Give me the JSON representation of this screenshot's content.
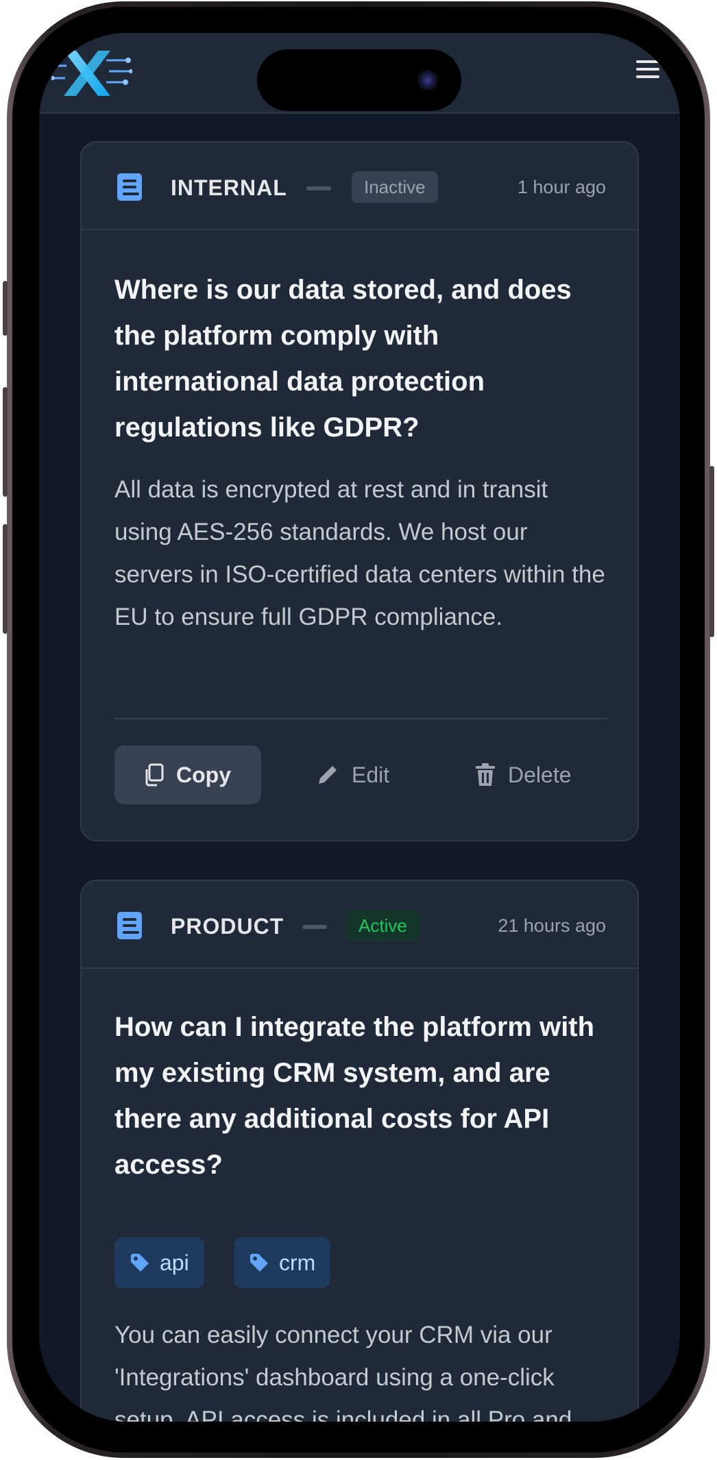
{
  "header": {
    "logo_alt": "X logo",
    "menu_icon": "hamburger-menu-icon"
  },
  "cards": [
    {
      "category": "INTERNAL",
      "status": "Inactive",
      "time": "1 hour ago",
      "question": "Where is our data stored, and does the platform comply with international data protection regulations like GDPR?",
      "answer": "All data is encrypted at rest and in transit using AES-256 standards. We host our servers in ISO-certified data centers within the EU to ensure full GDPR compliance.",
      "actions": {
        "copy": "Copy",
        "edit": "Edit",
        "delete": "Delete"
      }
    },
    {
      "category": "PRODUCT",
      "status": "Active",
      "time": "21 hours ago",
      "question": "How can I integrate the platform with my existing CRM system, and are there any additional costs for API access?",
      "tags": [
        "api",
        "crm"
      ],
      "answer": "You can easily connect your CRM via our 'Integrations' dashboard using a one-click setup. API access is included in all Pro and Enterprise plans at no extra cost. Check"
    }
  ],
  "colors": {
    "background": "#111827",
    "card": "#1f2937",
    "accent_blue": "#60a5fa",
    "active_green": "#22c55e"
  }
}
